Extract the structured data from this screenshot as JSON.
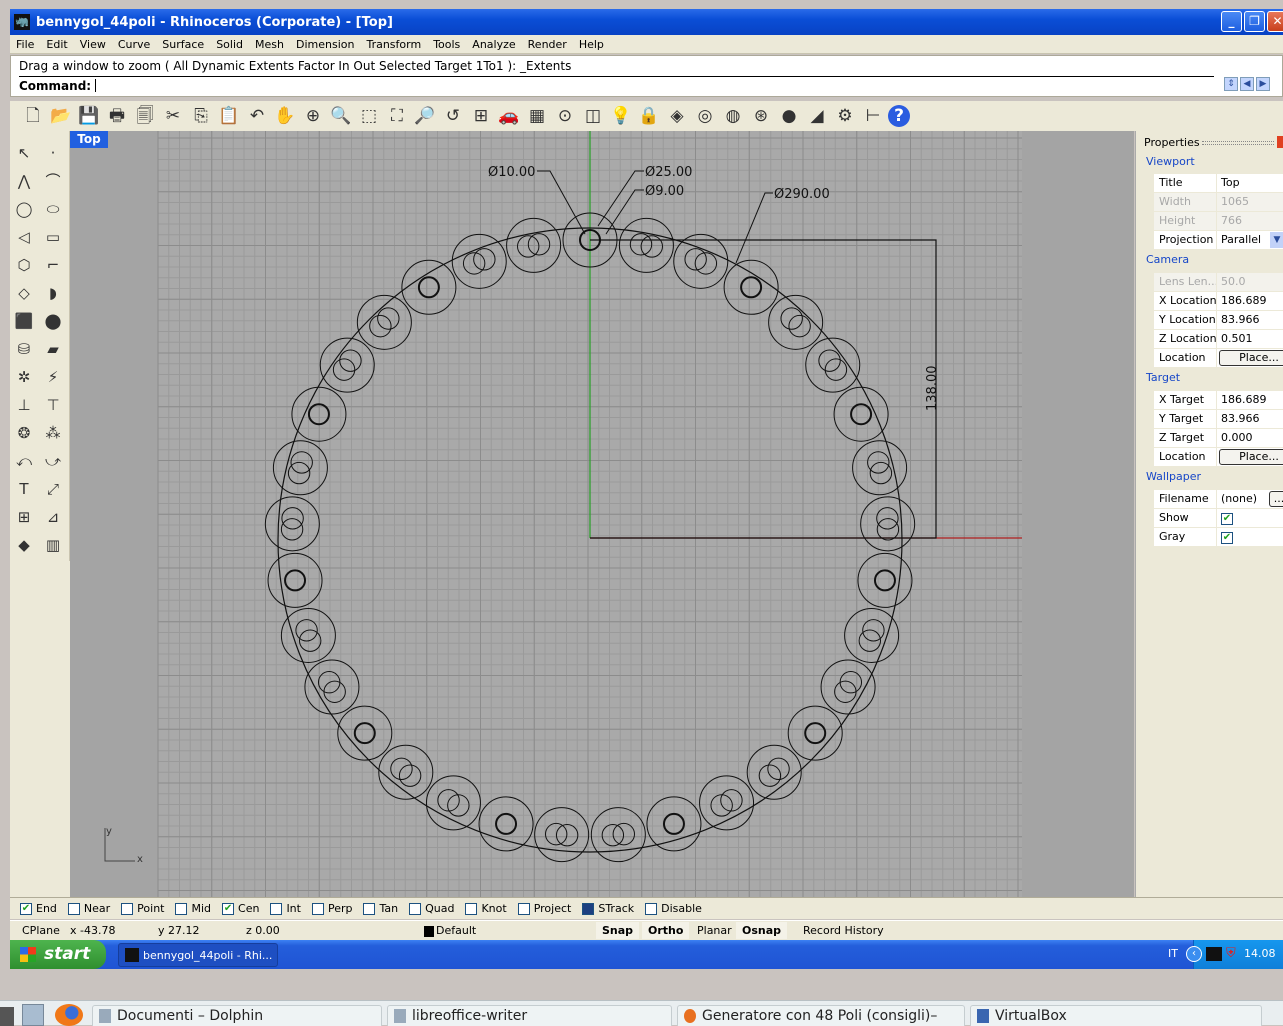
{
  "window": {
    "title": "bennygol_44poli - Rhinoceros (Corporate) - [Top]",
    "minimize_icon": "minimize-icon",
    "restore_icon": "restore-icon",
    "close_icon": "close-icon"
  },
  "menu": [
    "File",
    "Edit",
    "View",
    "Curve",
    "Surface",
    "Solid",
    "Mesh",
    "Dimension",
    "Transform",
    "Tools",
    "Analyze",
    "Render",
    "Help"
  ],
  "command": {
    "history": "Drag a window to zoom ( All  Dynamic  Extents  Factor  In  Out  Selected  Target  1To1 ): _Extents",
    "prompt": "Command:",
    "value": ""
  },
  "main_toolbar": [
    "new-file",
    "open-folder",
    "save",
    "print",
    "import",
    "cut",
    "copy",
    "paste",
    "undo",
    "pan-hand",
    "rotate-view",
    "zoom-dynamic",
    "zoom-window",
    "zoom-extents",
    "zoom-selected",
    "undo-view",
    "four-viewports",
    "car-named-views",
    "cplane-grid",
    "point-object",
    "snapshot",
    "light-bulb",
    "lock",
    "layer",
    "color-wheel",
    "wireframe-sphere",
    "grid-sphere",
    "render-sphere",
    "spotlight",
    "settings-gear",
    "dimension",
    "help"
  ],
  "left_toolbar": [
    "select-arrow",
    "point",
    "polyline",
    "curve-control",
    "circle",
    "ellipse",
    "arc",
    "rectangle",
    "polygon",
    "fillet-curve",
    "surface-corner",
    "surface-edge",
    "box",
    "sphere",
    "cylinder",
    "extrude",
    "transform-gear",
    "lightning",
    "split",
    "trim",
    "boolean-union",
    "boolean-split",
    "offset",
    "blend",
    "text",
    "scale",
    "array",
    "project",
    "solid-box",
    "dimension-hatch"
  ],
  "viewport": {
    "label": "Top",
    "axis_x": "x",
    "axis_y": "y",
    "dimensions": {
      "d10": "Ø10.00",
      "d25": "Ø25.00",
      "d9": "Ø9.00",
      "d290": "Ø290.00",
      "linear": "138.00"
    },
    "x_axis_color": "#b02020",
    "y_axis_color": "#30a030"
  },
  "properties": {
    "header": "Properties",
    "viewport_section": "Viewport",
    "viewport_rows": [
      {
        "k": "Title",
        "v": "Top"
      },
      {
        "k": "Width",
        "v": "1065",
        "disabled": true
      },
      {
        "k": "Height",
        "v": "766",
        "disabled": true
      },
      {
        "k": "Projection",
        "v": "Parallel"
      }
    ],
    "camera_section": "Camera",
    "camera_rows": [
      {
        "k": "Lens Len...",
        "v": "50.0",
        "disabled": true
      },
      {
        "k": "X Location",
        "v": "186.689"
      },
      {
        "k": "Y Location",
        "v": "83.966"
      },
      {
        "k": "Z Location",
        "v": "0.501"
      },
      {
        "k": "Location",
        "v": "Place..."
      }
    ],
    "target_section": "Target",
    "target_rows": [
      {
        "k": "X Target",
        "v": "186.689"
      },
      {
        "k": "Y Target",
        "v": "83.966"
      },
      {
        "k": "Z Target",
        "v": "0.000"
      },
      {
        "k": "Location",
        "v": "Place..."
      }
    ],
    "wallpaper_section": "Wallpaper",
    "wallpaper_rows": [
      {
        "k": "Filename",
        "v": "(none)",
        "btn": "..."
      },
      {
        "k": "Show",
        "checked": true
      },
      {
        "k": "Gray",
        "checked": true
      }
    ]
  },
  "osnaps": [
    {
      "label": "End",
      "checked": true
    },
    {
      "label": "Near",
      "checked": false
    },
    {
      "label": "Point",
      "checked": false
    },
    {
      "label": "Mid",
      "checked": false
    },
    {
      "label": "Cen",
      "checked": true
    },
    {
      "label": "Int",
      "checked": false
    },
    {
      "label": "Perp",
      "checked": false
    },
    {
      "label": "Tan",
      "checked": false
    },
    {
      "label": "Quad",
      "checked": false
    },
    {
      "label": "Knot",
      "checked": false
    },
    {
      "label": "Project",
      "checked": false
    },
    {
      "label": "STrack",
      "checked": true
    },
    {
      "label": "Disable",
      "checked": false
    }
  ],
  "status": {
    "cplane": "CPlane",
    "x": "x -43.78",
    "y": "y 27.12",
    "z": "z 0.00",
    "layer": "Default",
    "snap": "Snap",
    "ortho": "Ortho",
    "planar": "Planar",
    "osnap": "Osnap",
    "history": "Record History"
  },
  "xp_taskbar": {
    "start": "start",
    "task": "bennygol_44poli - Rhi...",
    "lang": "IT",
    "clock": "14.08"
  },
  "kde_taskbar": {
    "tasks": [
      "Documenti – Dolphin",
      "libreoffice-writer",
      "Generatore con 48 Poli (consigli)–",
      "VirtualBox"
    ]
  }
}
